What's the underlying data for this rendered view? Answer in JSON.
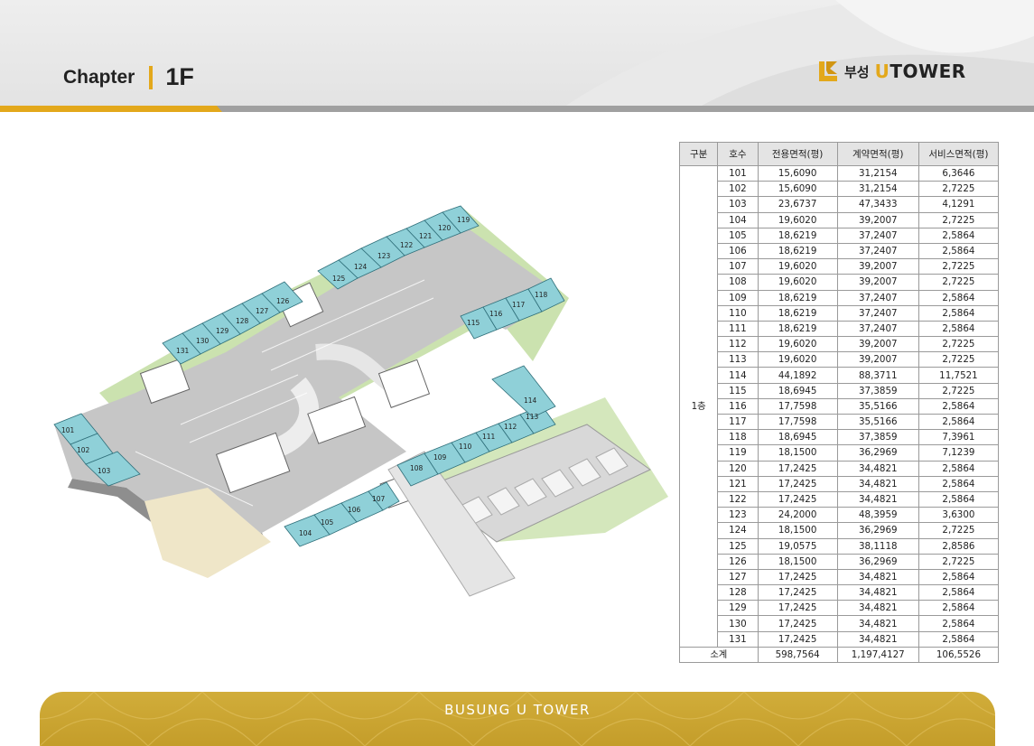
{
  "header": {
    "chapter_label": "Chapter",
    "floor": "1F"
  },
  "logo": {
    "korean": "부성",
    "brand_u": "U",
    "brand_rest": "TOWER"
  },
  "floor_plan": {
    "units": [
      {
        "no": "101"
      },
      {
        "no": "102"
      },
      {
        "no": "103"
      },
      {
        "no": "104"
      },
      {
        "no": "105"
      },
      {
        "no": "106"
      },
      {
        "no": "107"
      },
      {
        "no": "108"
      },
      {
        "no": "109"
      },
      {
        "no": "110"
      },
      {
        "no": "111"
      },
      {
        "no": "112"
      },
      {
        "no": "113"
      },
      {
        "no": "114"
      },
      {
        "no": "115"
      },
      {
        "no": "116"
      },
      {
        "no": "117"
      },
      {
        "no": "118"
      },
      {
        "no": "119"
      },
      {
        "no": "120"
      },
      {
        "no": "121"
      },
      {
        "no": "122"
      },
      {
        "no": "123"
      },
      {
        "no": "124"
      },
      {
        "no": "125"
      },
      {
        "no": "126"
      },
      {
        "no": "127"
      },
      {
        "no": "128"
      },
      {
        "no": "129"
      },
      {
        "no": "130"
      },
      {
        "no": "131"
      }
    ]
  },
  "table": {
    "headers": [
      "구분",
      "호수",
      "전용면적(평)",
      "계약면적(평)",
      "서비스면적(평)"
    ],
    "group_label": "1층",
    "rows": [
      [
        "101",
        "15,6090",
        "31,2154",
        "6,3646"
      ],
      [
        "102",
        "15,6090",
        "31,2154",
        "2,7225"
      ],
      [
        "103",
        "23,6737",
        "47,3433",
        "4,1291"
      ],
      [
        "104",
        "19,6020",
        "39,2007",
        "2,7225"
      ],
      [
        "105",
        "18,6219",
        "37,2407",
        "2,5864"
      ],
      [
        "106",
        "18,6219",
        "37,2407",
        "2,5864"
      ],
      [
        "107",
        "19,6020",
        "39,2007",
        "2,7225"
      ],
      [
        "108",
        "19,6020",
        "39,2007",
        "2,7225"
      ],
      [
        "109",
        "18,6219",
        "37,2407",
        "2,5864"
      ],
      [
        "110",
        "18,6219",
        "37,2407",
        "2,5864"
      ],
      [
        "111",
        "18,6219",
        "37,2407",
        "2,5864"
      ],
      [
        "112",
        "19,6020",
        "39,2007",
        "2,7225"
      ],
      [
        "113",
        "19,6020",
        "39,2007",
        "2,7225"
      ],
      [
        "114",
        "44,1892",
        "88,3711",
        "11,7521"
      ],
      [
        "115",
        "18,6945",
        "37,3859",
        "2,7225"
      ],
      [
        "116",
        "17,7598",
        "35,5166",
        "2,5864"
      ],
      [
        "117",
        "17,7598",
        "35,5166",
        "2,5864"
      ],
      [
        "118",
        "18,6945",
        "37,3859",
        "7,3961"
      ],
      [
        "119",
        "18,1500",
        "36,2969",
        "7,1239"
      ],
      [
        "120",
        "17,2425",
        "34,4821",
        "2,5864"
      ],
      [
        "121",
        "17,2425",
        "34,4821",
        "2,5864"
      ],
      [
        "122",
        "17,2425",
        "34,4821",
        "2,5864"
      ],
      [
        "123",
        "24,2000",
        "48,3959",
        "3,6300"
      ],
      [
        "124",
        "18,1500",
        "36,2969",
        "2,7225"
      ],
      [
        "125",
        "19,0575",
        "38,1118",
        "2,8586"
      ],
      [
        "126",
        "18,1500",
        "36,2969",
        "2,7225"
      ],
      [
        "127",
        "17,2425",
        "34,4821",
        "2,5864"
      ],
      [
        "128",
        "17,2425",
        "34,4821",
        "2,5864"
      ],
      [
        "129",
        "17,2425",
        "34,4821",
        "2,5864"
      ],
      [
        "130",
        "17,2425",
        "34,4821",
        "2,5864"
      ],
      [
        "131",
        "17,2425",
        "34,4821",
        "2,5864"
      ]
    ],
    "subtotal": {
      "label": "소계",
      "exclusive": "598,7564",
      "contract": "1,197,4127",
      "service": "106,5526"
    }
  },
  "footer": {
    "text": "BUSUNG U TOWER"
  },
  "colors": {
    "accent": "#e3a81b",
    "unit_fill": "#8fd0d8",
    "parking": "#c8c8c8",
    "grass": "#a9cf7a",
    "footer_gold": "#c9a333"
  }
}
